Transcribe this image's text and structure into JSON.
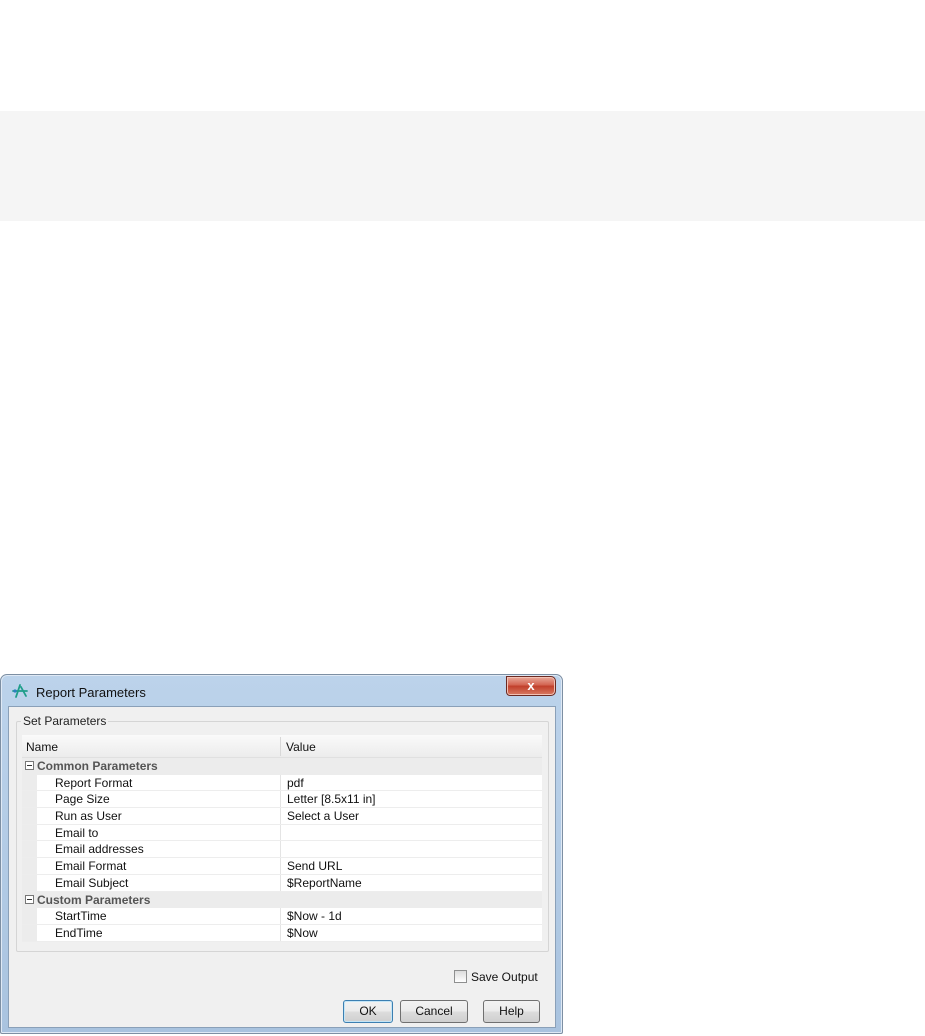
{
  "window": {
    "title": "Report Parameters",
    "close_label": "x"
  },
  "group": {
    "legend": "Set Parameters"
  },
  "grid": {
    "headers": {
      "name": "Name",
      "value": "Value"
    },
    "categories": [
      {
        "label": "Common Parameters",
        "rows": [
          {
            "name": "Report Format",
            "value": "pdf"
          },
          {
            "name": "Page Size",
            "value": "Letter [8.5x11 in]"
          },
          {
            "name": "Run as User",
            "value": "Select a User"
          },
          {
            "name": "Email to",
            "value": ""
          },
          {
            "name": "Email addresses",
            "value": ""
          },
          {
            "name": "Email Format",
            "value": "Send URL"
          },
          {
            "name": "Email Subject",
            "value": "$ReportName"
          }
        ]
      },
      {
        "label": "Custom Parameters",
        "rows": [
          {
            "name": "StartTime",
            "value": "$Now - 1d"
          },
          {
            "name": "EndTime",
            "value": "$Now"
          }
        ]
      }
    ]
  },
  "options": {
    "save_output_label": "Save Output",
    "save_output_checked": false
  },
  "buttons": {
    "ok": "OK",
    "cancel": "Cancel",
    "help": "Help"
  },
  "icons": {
    "title_icon": "report-app-icon",
    "toggle": "collapse-minus-icon"
  },
  "colors": {
    "frame": "#a9c3df",
    "close_button": "#c13f2b",
    "client_bg": "#f0f0f0"
  }
}
